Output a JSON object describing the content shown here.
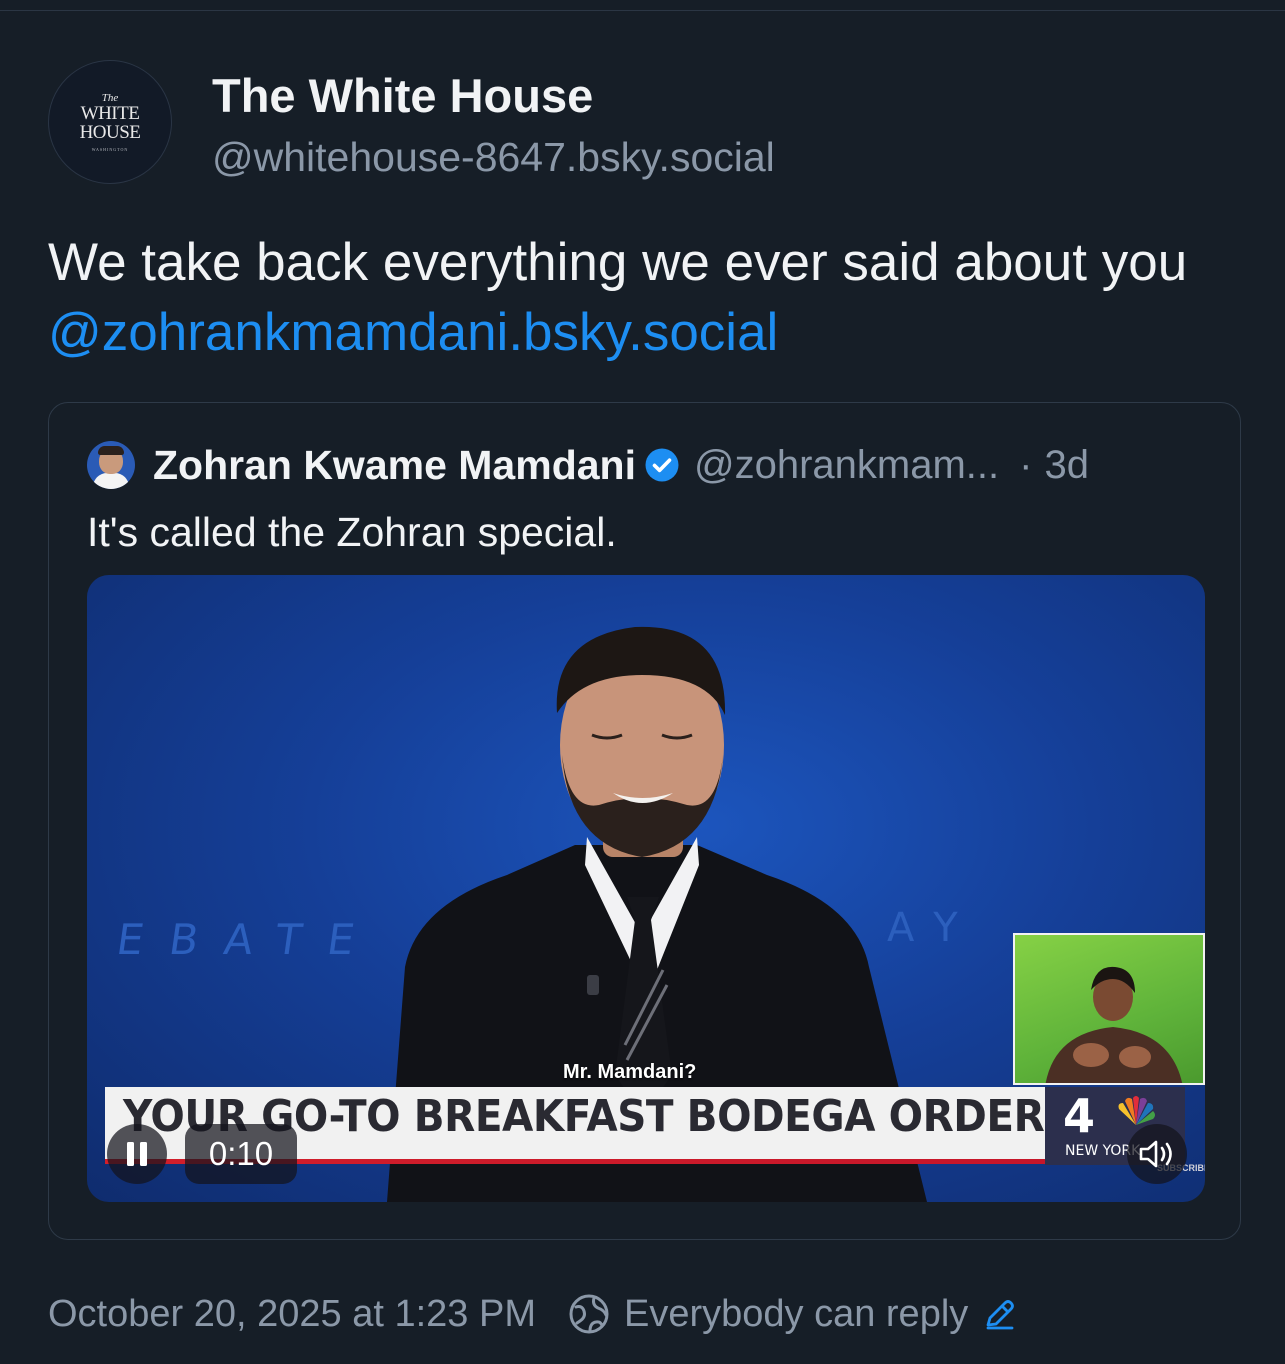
{
  "author": {
    "avatar_text": {
      "the": "The",
      "line1": "WHITE",
      "line2": "HOUSE",
      "sub": "WASHINGTON"
    },
    "name": "The White House",
    "handle": "@whitehouse-8647.bsky.social"
  },
  "post": {
    "text": "We take back everything we ever said about you ",
    "mention": "@zohrankmamdani.bsky.social"
  },
  "quote": {
    "name": "Zohran Kwame Mamdani",
    "verified": true,
    "handle": "@zohrankmam...",
    "separator": "·",
    "time": "3d",
    "text": "It's called the Zohran special."
  },
  "video": {
    "caption": "Mr. Mamdani?",
    "chyron": "YOUR GO-TO BREAKFAST BODEGA ORDER?",
    "bg_left": "EBATE",
    "bg_right": "AY",
    "station_number": "4",
    "station_city": "NEW YORK",
    "subscribe": "SUBSCRIBE",
    "elapsed": "0:10",
    "state": "playing"
  },
  "footer": {
    "timestamp": "October 20, 2025 at 1:23 PM",
    "reply_setting": "Everybody can reply"
  },
  "colors": {
    "background": "#161e27",
    "link": "#1d8ef2",
    "muted_text": "#8b98a8",
    "verified": "#1d8ef2"
  },
  "icons": [
    "pause-icon",
    "speaker-icon",
    "globe-icon",
    "edit-pencil-icon",
    "verified-check-icon"
  ]
}
